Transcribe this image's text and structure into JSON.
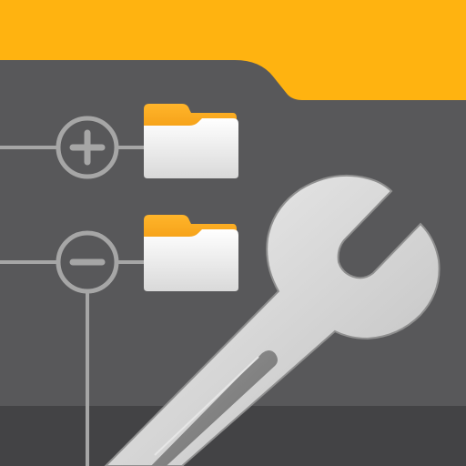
{
  "icon": {
    "kind": "file-manager-tools-app-icon",
    "elements": [
      "folder-background-icon",
      "tree-expand-plus-icon",
      "tree-collapse-minus-icon",
      "folder-icon",
      "wrench-icon"
    ],
    "colors": {
      "accent": "#ffb310",
      "panel": "#58585a",
      "panel_dark": "#434345",
      "tree_line": "#a6a6a6",
      "folder_tab": "#f5a623",
      "folder_body": "#ececec",
      "wrench": "#d9d9d9"
    }
  }
}
